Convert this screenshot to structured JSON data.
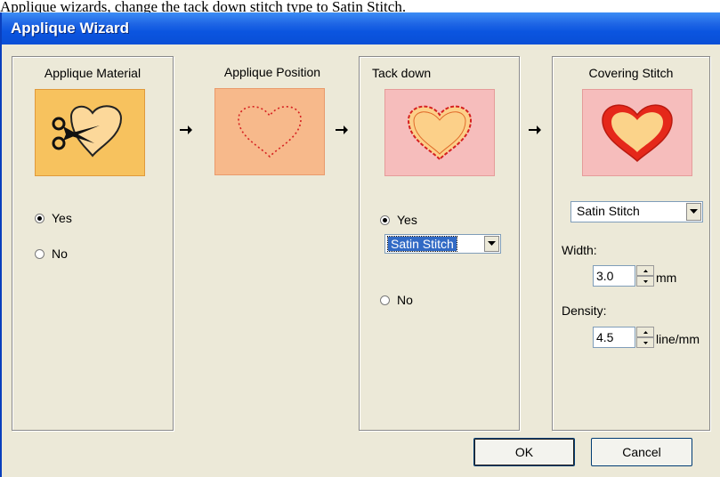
{
  "caption": "Applique wizards, change the tack down stitch type to Satin Stitch.",
  "window": {
    "title": "Applique Wizard"
  },
  "panels": {
    "material": {
      "title": "Applique Material",
      "icon": "scissors-heart-icon",
      "options": [
        {
          "label": "Yes",
          "checked": true
        },
        {
          "label": "No",
          "checked": false
        }
      ]
    },
    "position": {
      "title": "Applique Position",
      "icon": "dotted-heart-icon"
    },
    "tackdown": {
      "title": "Tack down",
      "icon": "zigzag-heart-icon",
      "yes_label": "Yes",
      "no_label": "No",
      "yes_checked": true,
      "stitch_value": "Satin Stitch"
    },
    "covering": {
      "title": "Covering Stitch",
      "icon": "satin-heart-icon",
      "stitch_value": "Satin Stitch",
      "width_label": "Width:",
      "width_value": "3.0",
      "width_unit": "mm",
      "density_label": "Density:",
      "density_value": "4.5",
      "density_unit": "line/mm"
    }
  },
  "buttons": {
    "ok": "OK",
    "cancel": "Cancel"
  },
  "colors": {
    "title_bar": "#0b55e0",
    "material_bg": "#f7c25e",
    "position_bg": "#f7b98b",
    "tackdown_bg": "#f6bdbc",
    "covering_bg": "#f6bdbc"
  }
}
